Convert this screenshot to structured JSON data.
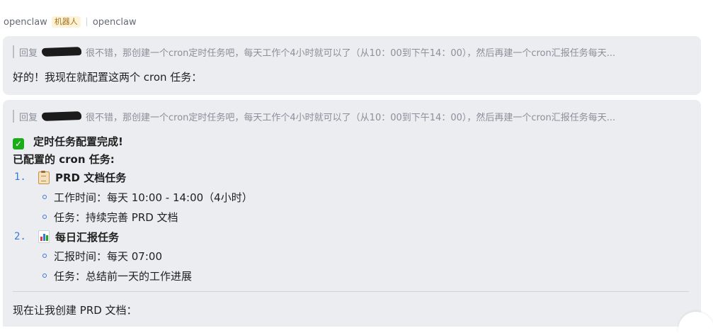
{
  "header": {
    "sender": "openclaw",
    "bot_badge": "机器人",
    "app_name": "openclaw"
  },
  "message1": {
    "quote_prefix": "回复",
    "quote_text": "很不错，那创建一个cron定时任务吧，每天工作个4小时就可以了（从10：00到下午14：00），然后再建一个cron汇报任务每天...",
    "body": "好的！我现在就配置这两个 cron 任务："
  },
  "message2": {
    "quote_prefix": "回复",
    "quote_text": "很不错，那创建一个cron定时任务吧，每天工作个4小时就可以了（从10：00到下午14：00），然后再建一个cron汇报任务每天...",
    "done_title": "定时任务配置完成!",
    "configured_heading": "已配置的 cron 任务:",
    "tasks": [
      {
        "num": "1.",
        "icon": "clipboard-icon",
        "title": "PRD 文档任务",
        "details": [
          "工作时间：每天 10:00 - 14:00（4小时）",
          "任务：持续完善 PRD 文档"
        ]
      },
      {
        "num": "2.",
        "icon": "bar-chart-icon",
        "title": "每日汇报任务",
        "details": [
          "汇报时间：每天 07:00",
          "任务：总结前一天的工作进展"
        ]
      }
    ],
    "next_line": "现在让我创建 PRD 文档："
  },
  "colors": {
    "bubble_bg": "#ebedf0",
    "accent_blue": "#3a77d8",
    "check_green": "#1aad19",
    "badge_bg": "#fdf3d6"
  }
}
